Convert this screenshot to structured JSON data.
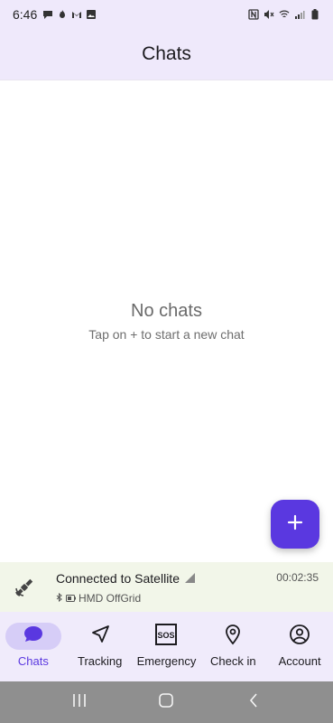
{
  "status_bar": {
    "time": "6:46",
    "left_icons": [
      "chat-bubble-icon",
      "fire-icon",
      "gmail-icon",
      "image-icon"
    ],
    "right_icons": [
      "nfc-icon",
      "mute-icon",
      "wifi-icon",
      "signal-icon",
      "battery-icon"
    ]
  },
  "app_bar": {
    "title": "Chats"
  },
  "empty_state": {
    "title": "No chats",
    "subtitle": "Tap on + to start a new chat"
  },
  "fab": {
    "icon": "plus-icon",
    "label": "+"
  },
  "satellite": {
    "status": "Connected to Satellite",
    "device": "HMD OffGrid",
    "timer": "00:02:35"
  },
  "nav": {
    "items": [
      {
        "label": "Chats",
        "icon": "chat-icon",
        "active": true
      },
      {
        "label": "Tracking",
        "icon": "navigation-arrow-icon",
        "active": false
      },
      {
        "label": "Emergency",
        "icon": "sos-icon",
        "active": false
      },
      {
        "label": "Check in",
        "icon": "location-pin-icon",
        "active": false
      },
      {
        "label": "Account",
        "icon": "account-circle-icon",
        "active": false
      }
    ]
  },
  "colors": {
    "accent": "#5a38e0",
    "header_bg": "#efe9fb",
    "nav_bg": "#f0ebfb",
    "active_pill": "#d6cdf7",
    "satellite_bg": "#f2f6e9"
  }
}
